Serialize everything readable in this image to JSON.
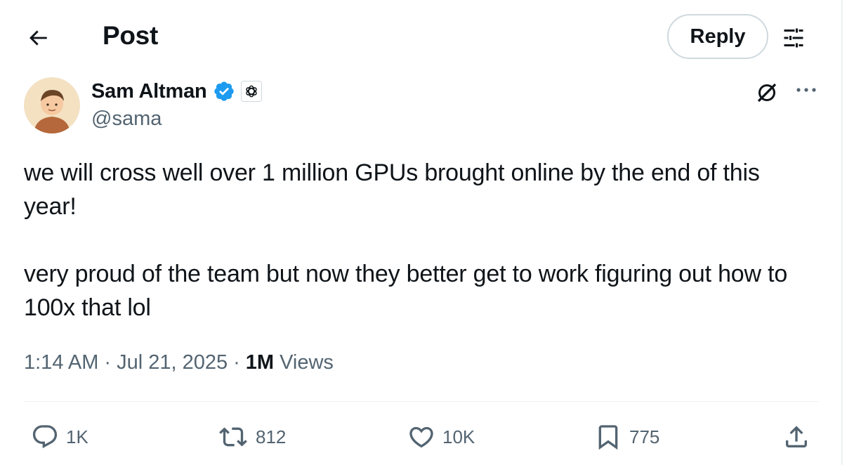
{
  "header": {
    "title": "Post",
    "reply_label": "Reply",
    "back_icon": "arrow-left-icon",
    "settings_icon": "sliders-icon"
  },
  "author": {
    "name": "Sam Altman",
    "handle": "@sama",
    "verified_icon": "verified-badge-icon",
    "affiliate_icon": "openai-logo-icon",
    "verified_color": "#1d9bf0"
  },
  "post": {
    "paragraphs": [
      "we will cross well over 1 million GPUs brought online by the end of this year!",
      "very proud of the team but now they better get to work figuring out how to 100x that lol"
    ],
    "time": "1:14 AM",
    "separator": "·",
    "date": "Jul 21, 2025",
    "views_count": "1M",
    "views_label": "Views"
  },
  "actions": {
    "replies": "1K",
    "reposts": "812",
    "likes": "10K",
    "bookmarks": "775"
  },
  "colors": {
    "text_primary": "#0f1419",
    "text_secondary": "#536471",
    "border": "#cfd9de",
    "divider": "#eff3f4"
  }
}
